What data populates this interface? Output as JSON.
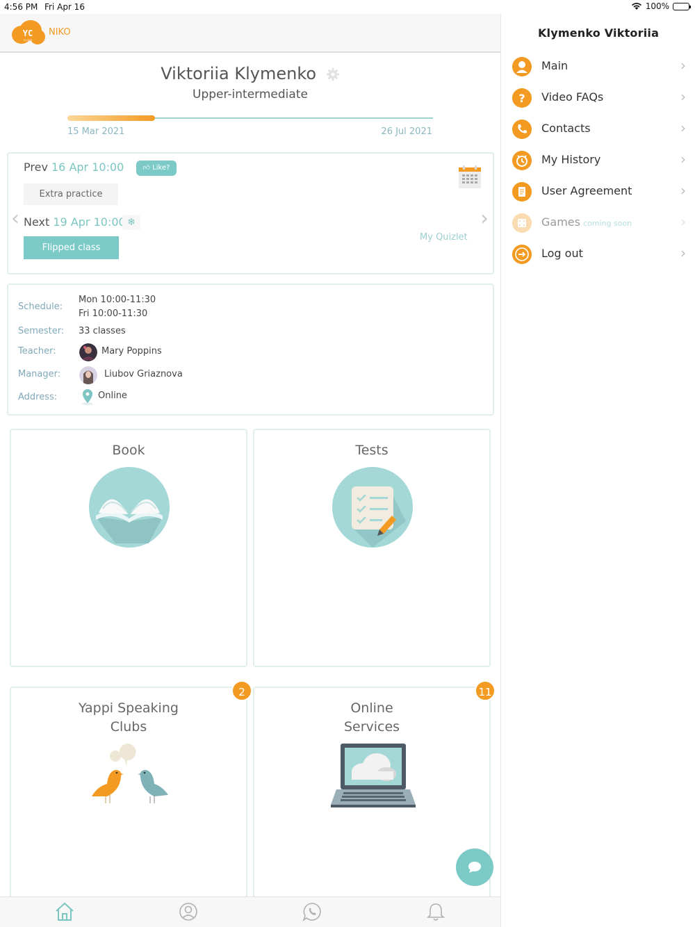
{
  "status_bar": {
    "time": "4:56 PM",
    "date": "Fri Apr 16",
    "battery": "100%"
  },
  "header": {
    "brand": "NIKO",
    "logo_text": "YC"
  },
  "profile": {
    "name": "Viktoriia Klymenko",
    "level": "Upper-intermediate",
    "start_date": "15 Mar 2021",
    "end_date": "26 Jul 2021",
    "progress": 0.24
  },
  "lessons": {
    "prev_label": "Prev",
    "prev_date": "16 Apr 10:00",
    "like_label": "Like?",
    "extra_practice": "Extra practice",
    "next_label": "Next",
    "next_date": "19 Apr 10:00",
    "flipped_label": "Flipped class",
    "quizlet_label": "My Quizlet"
  },
  "info": {
    "schedule_label": "Schedule:",
    "schedule_line1": "Mon 10:00-11:30",
    "schedule_line2": "Fri 10:00-11:30",
    "semester_label": "Semester:",
    "semester_value": "33 classes",
    "teacher_label": "Teacher:",
    "teacher_value": "Mary Poppins",
    "manager_label": "Manager:",
    "manager_value": "Liubov Griaznova",
    "address_label": "Address:",
    "address_value": "Online"
  },
  "tiles": {
    "book": "Book",
    "tests": "Tests",
    "yappi_line1": "Yappi Speaking",
    "yappi_line2": "Clubs",
    "yappi_badge": "2",
    "online_line1": "Online",
    "online_line2": "Services",
    "online_badge": "11"
  },
  "side_menu": {
    "title": "Klymenko Viktoriia",
    "items": [
      {
        "label": "Main",
        "icon": "user-icon"
      },
      {
        "label": "Video FAQs",
        "icon": "question-icon"
      },
      {
        "label": "Contacts",
        "icon": "phone-icon"
      },
      {
        "label": "My History",
        "icon": "clock-icon"
      },
      {
        "label": "User Agreement",
        "icon": "document-icon"
      },
      {
        "label": "Games",
        "icon": "dice-icon",
        "note": "coming soon"
      },
      {
        "label": "Log out",
        "icon": "logout-icon"
      }
    ]
  },
  "colors": {
    "accent": "#f39a23",
    "teal": "#7ccac8",
    "teal_light": "#a4d8d6"
  }
}
